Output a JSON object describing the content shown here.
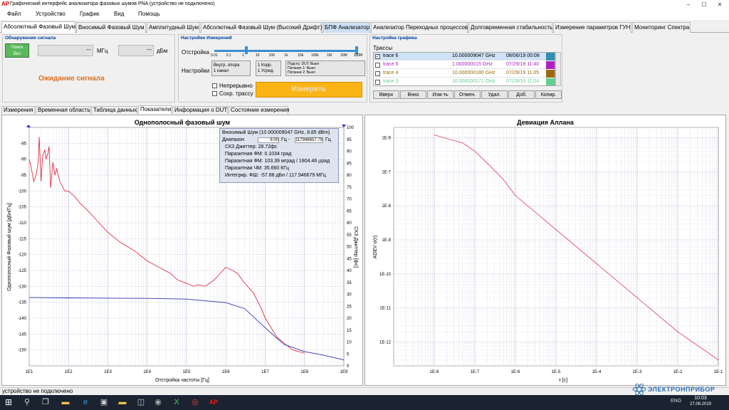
{
  "window": {
    "logo": "AP",
    "title": "Графический интерфейс анализатора фазовых шумов PNA (устройство не подключено)",
    "min": "–",
    "max": "☐",
    "close": "✕"
  },
  "menu": [
    "Файл",
    "Устройство",
    "График",
    "Вид",
    "Помощь"
  ],
  "tabs": [
    "Абсолютный Фазовый Шум",
    "Вносимый Фазовый Шум",
    "Амплитудный Шум",
    "Абсолютный Фазовый Шум (Высокий Дрифт)",
    "БПФ Анализатор",
    "Анализатор Переходных процессов",
    "Долговременная стабильность",
    "Измерение параметров ГУН",
    "Мониторинг Спектра"
  ],
  "signal": {
    "title": "Обнаружение сигнала",
    "search_btn1": "Поиск",
    "search_btn2": "Вкл",
    "freq_value": "---",
    "freq_unit": "МГц",
    "power_value": "---",
    "power_unit": "дБм",
    "status": "Ожидание сигнала"
  },
  "measure": {
    "title": "Настройки Измерений",
    "offset_label": "Отстройка",
    "ticks": [
      "0.01",
      "0.1",
      "1",
      "10",
      "100",
      "1k",
      "10k",
      "100k",
      "1M",
      "10M",
      "100M"
    ],
    "settings_label": "Настройки",
    "box1_l1": "Внутр. опора",
    "box1_l2": "1 канал",
    "box2_l1": "1 Корр.",
    "box2_l2": "1 Усред.",
    "box3_l1": "Подстр. DUT: Выкл",
    "box3_l2": "Питание 1: Выкл",
    "box3_l3": "Питание 2: Выкл",
    "continuous": "Непрерывно",
    "save_trace": "Сохр. трассу",
    "measure_btn": "Измерить"
  },
  "graph": {
    "title": "Настройка графика",
    "traces_label": "Трассы",
    "traces": [
      {
        "name": "trace 6",
        "freq": "10.000009047 GHz",
        "date": "08/06/19 00:08",
        "color": "#2e8fb0",
        "text_color": "#000",
        "checked": true,
        "selected": true
      },
      {
        "name": "trace 5",
        "freq": "1.000000015 GHz",
        "date": "07/29/19 11:40",
        "color": "#b020c0",
        "text_color": "#b020c0",
        "checked": false,
        "selected": false
      },
      {
        "name": "trace 4",
        "freq": "10.000000180 GHz",
        "date": "07/29/19 11:05",
        "color": "#9a6a10",
        "text_color": "#9a6a10",
        "checked": false,
        "selected": false
      },
      {
        "name": "trace 3",
        "freq": "10.000000171 GHz",
        "date": "07/29/19 11:04",
        "color": "#60d090",
        "text_color": "#60d090",
        "checked": false,
        "selected": false
      }
    ],
    "buttons": [
      "Вверх",
      "Вниз",
      "Изм-ть",
      "Отмен.",
      "Удал.",
      "Доб.",
      "Копир."
    ]
  },
  "subtabs": [
    "Измерения",
    "Временная область",
    "Таблица данных",
    "Показатели",
    "Информация о DUT",
    "Состояние измерения"
  ],
  "left_chart": {
    "title": "Однополосный фазовый шум",
    "xlabel": "Отстройка частоты [Гц]",
    "ylabel": "Однополосный Фазовый шум [дБн/Гц]",
    "y2label": "СКЗ Джиттер [фс]",
    "info": {
      "l1": "Вносимый Шум (10.000009047 GHz, 8.85 dBm)",
      "range_label": "Диапазон",
      "range_from": "9.00",
      "range_mid": "Гц -",
      "range_to": "117946657.79",
      "range_unit": "Гц",
      "l3": "СКЗ Джиттер: 28.72фс",
      "l4": "Паразитная ФМ: 0.1034 град",
      "l5": "Паразитная ФМ: 103.39 мград / 1804.46 µрад",
      "l6": "Паразитная ЧМ: 35.660 КГц",
      "l7": "Интегрир. ФШ: -57.88 дБн / 117.946679 МГц"
    }
  },
  "right_chart": {
    "title": "Девиация Аллана",
    "xlabel": "τ [с]",
    "ylabel": "ADEV σ(τ)"
  },
  "chart_data": [
    {
      "type": "line",
      "title": "Однополосный фазовый шум",
      "xlabel": "Отстройка частоты [Гц]",
      "ylabel": "Однополосный Фазовый шум [дБн/Гц]",
      "y2label": "СКЗ Джиттер [фс]",
      "x_scale": "log",
      "xlim": [
        10,
        1000000000
      ],
      "ylim": [
        -155,
        -80
      ],
      "y2lim": [
        0,
        100
      ],
      "x_ticks": [
        "1E1",
        "1E2",
        "1E3",
        "1E4",
        "1E5",
        "1E6",
        "1E7",
        "1E8",
        "1E9"
      ],
      "y_ticks": [
        -85,
        -90,
        -95,
        -100,
        -105,
        -110,
        -115,
        -120,
        -125,
        -130,
        -135,
        -140,
        -145,
        -150
      ],
      "y2_ticks": [
        0,
        5,
        10,
        15,
        20,
        25,
        30,
        35,
        40,
        45,
        50,
        55,
        60,
        65,
        70,
        75,
        80,
        85,
        90,
        95,
        100
      ],
      "grid": true,
      "series": [
        {
          "color": "#e03040",
          "axis": "left",
          "x": [
            10,
            11,
            13,
            15,
            17,
            18,
            20,
            22,
            25,
            27,
            30,
            32,
            35,
            40,
            45,
            50,
            60,
            80,
            100,
            150,
            200,
            300,
            500,
            1000,
            2000,
            5000,
            10000,
            20000,
            40000,
            60000,
            100000,
            150000,
            200000,
            300000,
            500000,
            700000,
            1000000,
            1500000,
            2000000,
            3000000,
            5000000,
            8000000,
            10000000,
            20000000,
            50000000,
            100000000
          ],
          "y": [
            -90,
            -92,
            -97,
            -95,
            -91,
            -83,
            -97,
            -89,
            -87,
            -90,
            -88,
            -86,
            -99,
            -91,
            -95,
            -93,
            -97,
            -100,
            -100,
            -102,
            -104,
            -106,
            -109,
            -113,
            -116,
            -119,
            -122,
            -124,
            -126,
            -128,
            -129,
            -130,
            -129.5,
            -130,
            -128,
            -126,
            -124,
            -125,
            -126,
            -129,
            -132,
            -137,
            -140,
            -146,
            -150,
            -151
          ]
        },
        {
          "color": "#3030b0",
          "axis": "right",
          "x": [
            10,
            100,
            1000,
            10000,
            100000,
            1000000,
            3000000,
            10000000,
            30000000,
            100000000,
            300000000,
            1000000000
          ],
          "y": [
            28.7,
            28.5,
            28.4,
            28.3,
            28.0,
            26.5,
            24,
            16,
            9,
            6,
            4.5,
            2.5
          ]
        }
      ]
    },
    {
      "type": "line",
      "title": "Девиация Аллана",
      "xlabel": "τ [с]",
      "ylabel": "ADEV σ(τ)",
      "x_scale": "log",
      "y_scale": "log",
      "xlim": [
        1e-09,
        0.1
      ],
      "ylim": [
        2e-13,
        2e-06
      ],
      "x_ticks": [
        "1E-8",
        "1E-7",
        "1E-6",
        "1E-5",
        "1E-4",
        "1E-3",
        "1E-2",
        "1E-1"
      ],
      "y_ticks": [
        "1E-6",
        "1E-7",
        "1E-8",
        "1E-9",
        "1E-10",
        "1E-11",
        "1E-12"
      ],
      "grid": true,
      "series": [
        {
          "color": "#e05070",
          "x": [
            1e-08,
            2e-08,
            5e-08,
            1e-07,
            2e-07,
            5e-07,
            1e-06,
            1e-05,
            0.0001,
            0.001,
            0.01,
            0.1
          ],
          "y": [
            1.2e-06,
            9.5e-07,
            7e-07,
            4e-07,
            1.8e-07,
            6e-08,
            2e-08,
            2e-09,
            2e-10,
            2e-11,
            2e-12,
            3e-13
          ]
        }
      ]
    }
  ],
  "status_text": "устройство не подключено",
  "watermark": "ЭЛЕКТРОНПРИБОР",
  "tray": {
    "time": "10:03",
    "date": "27.08.2019",
    "lang": "ENG"
  }
}
